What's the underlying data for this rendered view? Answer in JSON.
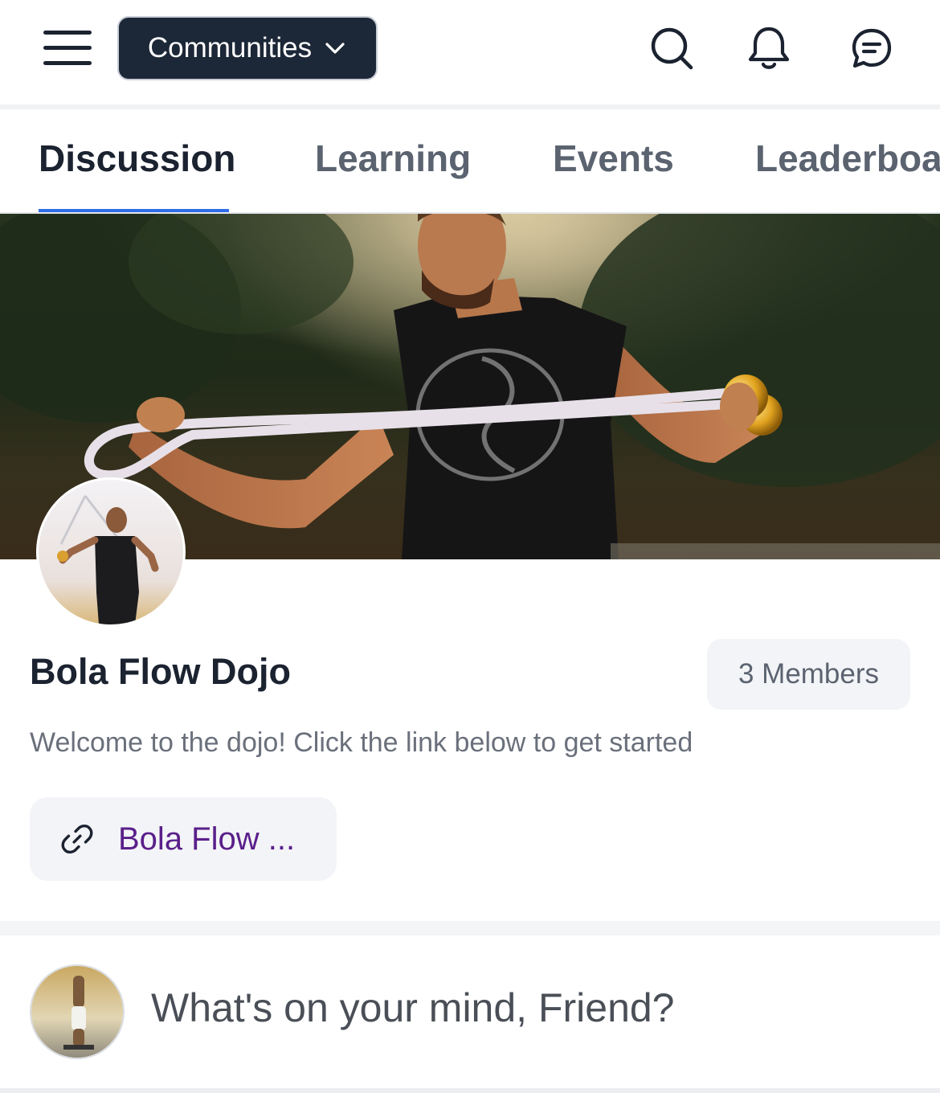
{
  "header": {
    "communities_label": "Communities",
    "icons": [
      "hamburger-menu-icon",
      "chevron-down-icon",
      "search-icon",
      "bell-icon",
      "chat-icon"
    ]
  },
  "tabs": [
    {
      "label": "Discussion",
      "active": true
    },
    {
      "label": "Learning",
      "active": false
    },
    {
      "label": "Events",
      "active": false
    },
    {
      "label": "Leaderboa",
      "active": false
    }
  ],
  "community": {
    "name": "Bola Flow Dojo",
    "members": "3 Members",
    "welcome": "Welcome to the dojo! Click the link below to get started",
    "link_text": "Bola Flow ..."
  },
  "composer": {
    "placeholder": "What's on your mind, Friend?"
  },
  "colors": {
    "accent": "#2e6ee6",
    "dark": "#1c2737",
    "link": "#5a1f8a"
  }
}
